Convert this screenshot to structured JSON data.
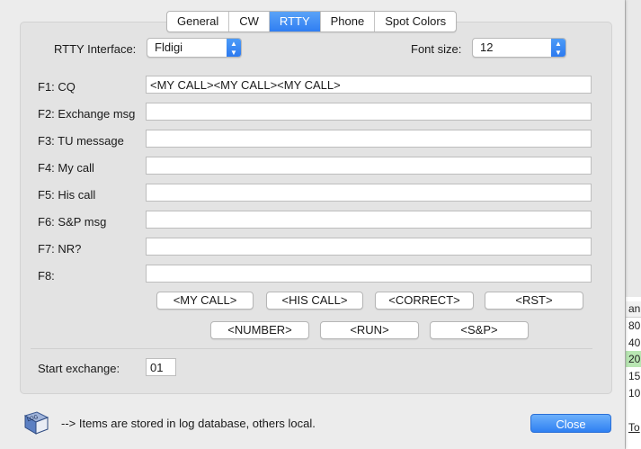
{
  "tabs": [
    {
      "label": "General",
      "active": false
    },
    {
      "label": "CW",
      "active": false
    },
    {
      "label": "RTTY",
      "active": true
    },
    {
      "label": "Phone",
      "active": false
    },
    {
      "label": "Spot Colors",
      "active": false
    }
  ],
  "rtty_interface": {
    "label": "RTTY Interface:",
    "value": "Fldigi"
  },
  "font_size": {
    "label": "Font size:",
    "value": "12"
  },
  "function_keys": [
    {
      "label": "F1: CQ",
      "value": "<MY CALL><MY CALL><MY CALL>"
    },
    {
      "label": "F2: Exchange msg",
      "value": ""
    },
    {
      "label": "F3: TU message",
      "value": ""
    },
    {
      "label": "F4: My call",
      "value": ""
    },
    {
      "label": "F5: His call",
      "value": ""
    },
    {
      "label": "F6: S&P msg",
      "value": ""
    },
    {
      "label": "F7: NR?",
      "value": ""
    },
    {
      "label": "F8:",
      "value": ""
    }
  ],
  "macros": [
    "<MY CALL>",
    "<HIS CALL>",
    "<CORRECT>",
    "<RST>",
    "<NUMBER>",
    "<RUN>",
    "<S&P>"
  ],
  "start_exchange": {
    "label": "Start exchange:",
    "value": "01"
  },
  "footer": {
    "note": "--> Items are stored in log database, others local.",
    "icon_text": "LOG",
    "close_label": "Close"
  },
  "background_window": {
    "cells": [
      "an",
      "80",
      "40",
      "20",
      "15",
      "10"
    ],
    "link": "To"
  },
  "colors": {
    "accent": "#2f7ef2",
    "highlight_row": "#b9e6b3"
  }
}
